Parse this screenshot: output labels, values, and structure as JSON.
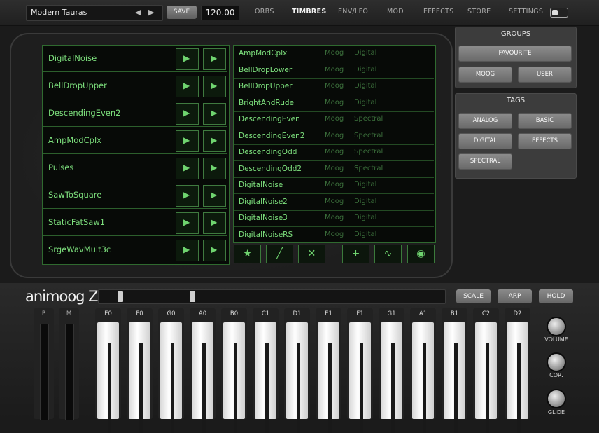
{
  "header": {
    "preset_name": "Modern Tauras",
    "prev_icon": "◀",
    "next_icon": "▶",
    "save_label": "SAVE",
    "tempo": "120.00",
    "tabs": [
      "ORBS",
      "TIMBRES",
      "ENV/LFO",
      "MOD",
      "EFFECTS",
      "STORE",
      "SETTINGS"
    ],
    "active_tab": "TIMBRES"
  },
  "orbs": [
    "DigitalNoise",
    "BellDropUpper",
    "DescendingEven2",
    "AmpModCplx",
    "Pulses",
    "SawToSquare",
    "StaticFatSaw1",
    "SrgeWavMult3c"
  ],
  "timbres": [
    {
      "name": "AmpModCplx",
      "brand": "Moog",
      "type": "Digital"
    },
    {
      "name": "BellDropLower",
      "brand": "Moog",
      "type": "Digital"
    },
    {
      "name": "BellDropUpper",
      "brand": "Moog",
      "type": "Digital"
    },
    {
      "name": "BrightAndRude",
      "brand": "Moog",
      "type": "Digital"
    },
    {
      "name": "DescendingEven",
      "brand": "Moog",
      "type": "Spectral"
    },
    {
      "name": "DescendingEven2",
      "brand": "Moog",
      "type": "Spectral"
    },
    {
      "name": "DescendingOdd",
      "brand": "Moog",
      "type": "Spectral"
    },
    {
      "name": "DescendingOdd2",
      "brand": "Moog",
      "type": "Spectral"
    },
    {
      "name": "DigitalNoise",
      "brand": "Moog",
      "type": "Digital"
    },
    {
      "name": "DigitalNoise2",
      "brand": "Moog",
      "type": "Digital"
    },
    {
      "name": "DigitalNoise3",
      "brand": "Moog",
      "type": "Digital"
    },
    {
      "name": "DigitalNoiseRS",
      "brand": "Moog",
      "type": "Digital"
    }
  ],
  "toolbar": {
    "favourite_icon": "★",
    "rename_icon": "╱",
    "delete_icon": "✕",
    "add_icon": "+",
    "waveform_icon": "∿",
    "record_icon": "◉"
  },
  "groups": {
    "title": "GROUPS",
    "favourite": "FAVOURITE",
    "moog": "MOOG",
    "user": "USER"
  },
  "tags": {
    "title": "TAGS",
    "analog": "ANALOG",
    "basic": "BASIC",
    "digital": "DIGITAL",
    "effects": "EFFECTS",
    "spectral": "SPECTRAL"
  },
  "keyboard": {
    "logo": "animoog Z",
    "scale": "SCALE",
    "arp": "ARP",
    "hold": "HOLD",
    "strips": [
      "P",
      "M"
    ],
    "keys": [
      "E0",
      "F0",
      "G0",
      "A0",
      "B0",
      "C1",
      "D1",
      "E1",
      "F1",
      "G1",
      "A1",
      "B1",
      "C2",
      "D2"
    ],
    "knobs": [
      "VOLUME",
      "COR.",
      "GLIDE"
    ]
  },
  "colors": {
    "screen_green": "#7de07d",
    "dim_green": "#3b6f3b",
    "panel_gray": "#3c3c3c"
  }
}
